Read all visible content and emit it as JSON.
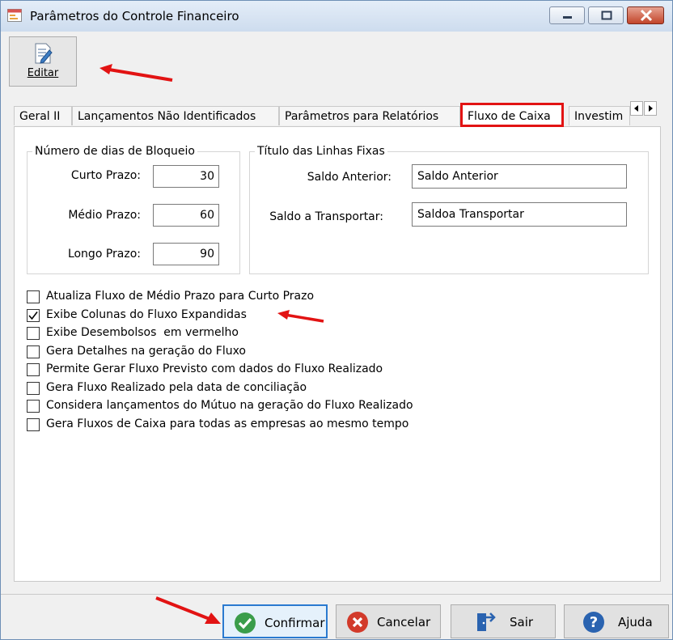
{
  "window": {
    "title": "Parâmetros do Controle Financeiro"
  },
  "toolbar": {
    "edit_label": "Editar"
  },
  "tabs": [
    {
      "label": "Geral II"
    },
    {
      "label": "Lançamentos Não Identificados"
    },
    {
      "label": "Parâmetros para Relatórios"
    },
    {
      "label": "Fluxo de Caixa"
    },
    {
      "label": "Investim"
    }
  ],
  "active_tab": "Fluxo de Caixa",
  "blocking": {
    "legend": "Número de dias de Bloqueio",
    "short_label": "Curto Prazo:",
    "short_value": "30",
    "medium_label": "Médio Prazo:",
    "medium_value": "60",
    "long_label": "Longo Prazo:",
    "long_value": "90"
  },
  "fixed_lines": {
    "legend": "Título das Linhas Fixas",
    "previous_label": "Saldo Anterior:",
    "previous_value": "Saldo Anterior",
    "transport_label": "Saldo a Transportar:",
    "transport_value": "Saldoa Transportar"
  },
  "options": [
    {
      "label": "Atualiza Fluxo de Médio Prazo para Curto Prazo",
      "checked": false
    },
    {
      "label": "Exibe Colunas do Fluxo Expandidas",
      "checked": true
    },
    {
      "label": "Exibe Desembolsos  em vermelho",
      "checked": false
    },
    {
      "label": "Gera Detalhes na geração do Fluxo",
      "checked": false
    },
    {
      "label": "Permite Gerar Fluxo Previsto com dados do Fluxo Realizado",
      "checked": false
    },
    {
      "label": "Gera Fluxo Realizado pela data de conciliação",
      "checked": false
    },
    {
      "label": "Considera lançamentos do Mútuo na geração do Fluxo Realizado",
      "checked": false
    },
    {
      "label": "Gera Fluxos de Caixa para todas as empresas ao mesmo tempo",
      "checked": false
    }
  ],
  "footer": {
    "confirm_label": "Confirmar",
    "cancel_label": "Cancelar",
    "exit_label": "Sair",
    "help_label": "Ajuda"
  },
  "colors": {
    "highlight": "#e21313",
    "accent": "#2a7ad0",
    "confirm": "#3a9d4b",
    "cancel": "#d23a2a",
    "help": "#2a63b0"
  }
}
